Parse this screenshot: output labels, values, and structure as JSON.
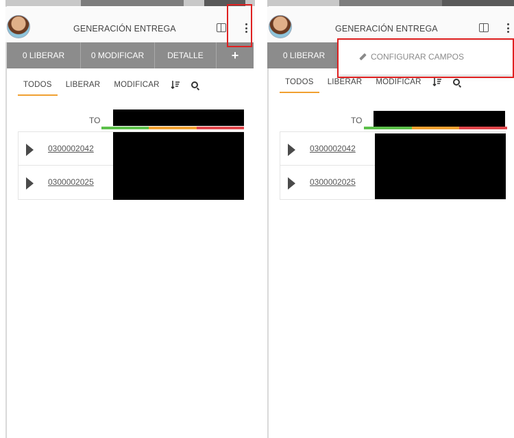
{
  "left_panel": {
    "header": {
      "title": "GENERACIÓN ENTREGA"
    },
    "toolbar": {
      "liberar": "0 LIBERAR",
      "modificar": "0 MODIFICAR",
      "detalle": "DETALLE",
      "add": "+"
    },
    "tabs": {
      "todos": "TODOS",
      "liberar": "LIBERAR",
      "modificar": "MODIFICAR"
    },
    "to_label": "TO",
    "rows": [
      {
        "id": "0300002042"
      },
      {
        "id": "0300002025"
      }
    ]
  },
  "right_panel": {
    "header": {
      "title": "GENERACIÓN ENTREGA"
    },
    "toolbar": {
      "liberar": "0 LIBERAR"
    },
    "dropdown": {
      "item": "CONFIGURAR CAMPOS"
    },
    "tabs": {
      "todos": "TODOS",
      "liberar": "LIBERAR",
      "modificar": "MODIFICAR"
    },
    "to_label": "TO",
    "rows": [
      {
        "id": "0300002042"
      },
      {
        "id": "0300002025"
      }
    ]
  },
  "colors": {
    "toolbar_bg": "#8c8c8c",
    "active_tab": "#f0a030",
    "progress_green": "#5cc04a",
    "progress_orange": "#f0a030",
    "progress_red": "#e0454a",
    "highlight": "#e02020"
  },
  "icons": [
    "split-view-icon",
    "kebab-menu-icon",
    "sort-icon",
    "search-icon",
    "caret-right-icon",
    "pencil-icon"
  ]
}
